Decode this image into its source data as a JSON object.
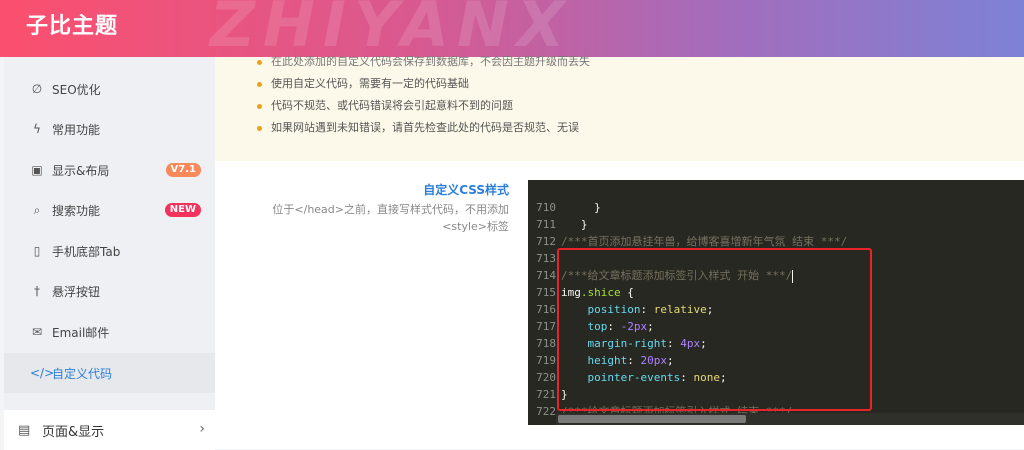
{
  "header": {
    "title": "子比主题",
    "watermark": "ZHIYANX"
  },
  "sidebar": {
    "items": [
      {
        "label": "SEO优化",
        "icon": "seo-icon"
      },
      {
        "label": "常用功能",
        "icon": "bolt-icon"
      },
      {
        "label": "显示&布局",
        "icon": "layout-icon",
        "badge": "V7.1"
      },
      {
        "label": "搜索功能",
        "icon": "search-icon",
        "badge": "NEW"
      },
      {
        "label": "手机底部Tab",
        "icon": "mobile-icon"
      },
      {
        "label": "悬浮按钮",
        "icon": "pin-icon"
      },
      {
        "label": "Email邮件",
        "icon": "mail-icon"
      },
      {
        "label": "自定义代码",
        "icon": "code-icon",
        "active": true
      }
    ],
    "group": {
      "label": "页面&显示",
      "icon": "page-icon"
    }
  },
  "notice": {
    "items": [
      "在此处添加的自定义代码会保存到数据库，不会因主题升级而丢失",
      "使用自定义代码，需要有一定的代码基础",
      "代码不规范、或代码错误将会引起意料不到的问题",
      "如果网站遇到未知错误，请首先检查此处的代码是否规范、无误"
    ]
  },
  "field": {
    "title": "自定义CSS样式",
    "description": "位于</head>之前，直接写样式代码，不用添加<style>标签"
  },
  "editor": {
    "lines": [
      {
        "num": "710",
        "text": "     }"
      },
      {
        "num": "711",
        "text": "   }"
      },
      {
        "num": "712",
        "text": "/***首页添加悬挂年兽，给博客喜增新年气氛 结束 ***/"
      },
      {
        "num": "713",
        "text": ""
      },
      {
        "num": "714",
        "text": "/***给文章标题添加标签引入样式 开始 ***/"
      },
      {
        "num": "715",
        "selector": "img",
        "class_name": ".shice",
        "brace": " {"
      },
      {
        "num": "716",
        "prop": "position",
        "value": "relative"
      },
      {
        "num": "717",
        "prop": "top",
        "value": "-2px"
      },
      {
        "num": "718",
        "prop": "margin-right",
        "value": "4px"
      },
      {
        "num": "719",
        "prop": "height",
        "value": "20px"
      },
      {
        "num": "720",
        "prop": "pointer-events",
        "value": "none"
      },
      {
        "num": "721",
        "text": "}"
      },
      {
        "num": "722",
        "text": "/***给文章标题添加标签引入样式 结束 ***/"
      }
    ]
  },
  "colors": {
    "accent": "#2b7fd9",
    "highlight": "#e8242a",
    "badge_orange": "#f7895a",
    "badge_red": "#f4335d"
  }
}
